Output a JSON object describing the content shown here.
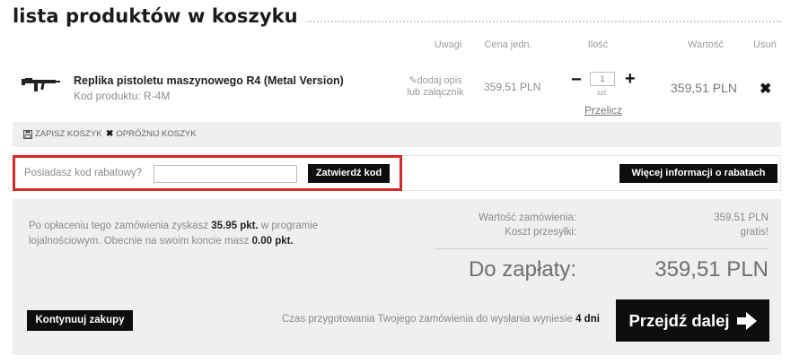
{
  "page": {
    "title": "lista produktów w koszyku"
  },
  "columns": {
    "notes": "Uwagi",
    "unit_price": "Cena jedn.",
    "quantity": "Ilość",
    "value": "Wartość",
    "remove": "Usuń"
  },
  "cart": {
    "items": [
      {
        "name": "Replika pistoletu maszynowego R4 (Metal Version)",
        "code": "Kod produktu: R-4M",
        "note_line1": "dodaj opis",
        "note_line2": "lub załącznik",
        "unit_price": "359,51 PLN",
        "quantity": "1",
        "unit": "szt.",
        "minus": "−",
        "plus": "+",
        "recalc": "Przelicz",
        "total": "359,51 PLN",
        "remove": "✖",
        "icon": "rifle-icon"
      }
    ],
    "save_cart": "ZAPISZ KOSZYK",
    "empty_cart": "OPRÓŻNIJ KOSZYK"
  },
  "discount": {
    "label": "Posiadasz kod rabatowy?",
    "value": "",
    "submit": "Zatwierdź kod",
    "more_info": "Więcej informacji o rabatach"
  },
  "summary": {
    "loyalty_pre": "Po opłaceniu tego zamówienia zyskasz ",
    "loyalty_points": "35.95 pkt.",
    "loyalty_mid": " w programie lojalnościowym. Obecnie na swoim koncie masz ",
    "loyalty_balance": "0.00 pkt.",
    "order_value_label": "Wartość zamówienia:",
    "order_value": "359,51 PLN",
    "shipping_label": "Koszt przesyłki:",
    "shipping_value": "gratis!",
    "to_pay_label": "Do zapłaty:",
    "to_pay_value": "359,51 PLN",
    "continue_button": "Kontynuuj zakupy",
    "prep_text": "Czas przygotowania Twojego zamówienia do wysłania wyniesie ",
    "prep_days": "4 dni",
    "next_button": "Przejdź dalej"
  },
  "colors": {
    "highlight": "#d42a2a",
    "button": "#0d0d0d",
    "panel": "#efefef"
  }
}
